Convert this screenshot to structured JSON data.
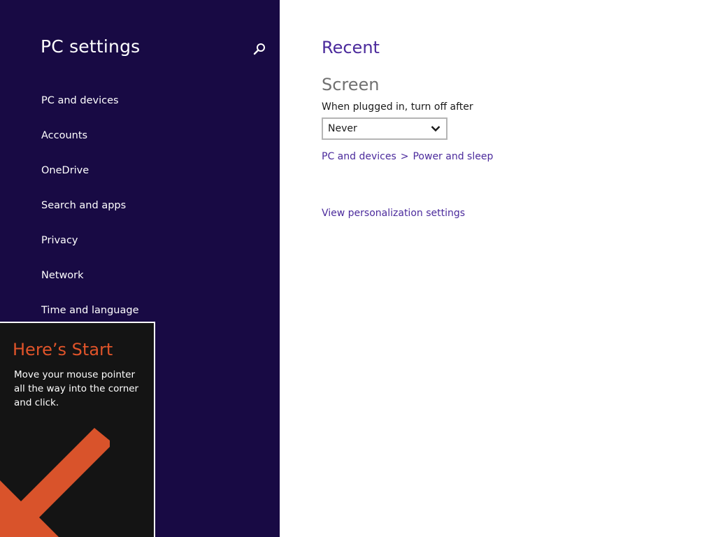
{
  "sidebar": {
    "title": "PC settings",
    "search_icon": "search-icon",
    "items": [
      {
        "label": "PC and devices"
      },
      {
        "label": "Accounts"
      },
      {
        "label": "OneDrive"
      },
      {
        "label": "Search and apps"
      },
      {
        "label": "Privacy"
      },
      {
        "label": "Network"
      },
      {
        "label": "Time and language"
      }
    ]
  },
  "start_tip": {
    "title": "Here’s Start",
    "body": "Move your mouse pointer all the way into the corner and click.",
    "arrow_icon": "arrow-down-left-icon"
  },
  "main": {
    "heading": "Recent",
    "group_title": "Screen",
    "setting_label": "When plugged in, turn off after",
    "dropdown": {
      "selected": "Never",
      "icon": "chevron-down-icon"
    },
    "breadcrumb": {
      "first": "PC and devices",
      "separator": ">",
      "second": "Power and sleep"
    },
    "link": "View personalization settings"
  },
  "colors": {
    "sidebar_bg": "#180a44",
    "accent": "#4b2a9c",
    "tip_title": "#e0542a",
    "tip_bg": "#141414",
    "arrow": "#d9532b"
  }
}
